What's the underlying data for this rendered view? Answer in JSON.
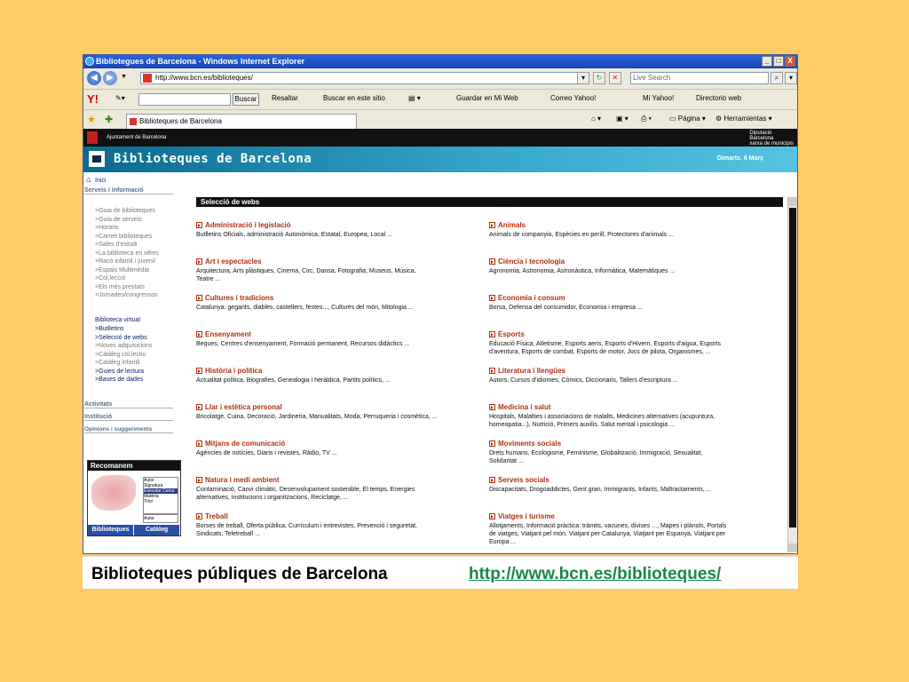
{
  "window": {
    "title": "Bibliotegues de Barcelona - Windows Internet Explorer",
    "minimize": "_",
    "maximize": "□",
    "close": "X"
  },
  "address": {
    "url": "http://www.bcn.es/biblioteques/",
    "live_search_placeholder": "Live Search"
  },
  "yahoo_toolbar": {
    "search_button": "Buscar",
    "items": [
      "Resaltar",
      "Buscar en este sitio",
      "Guardar en Mi Web",
      "Correo Yahoo!",
      "Mi Yahoo!",
      "Directorio web"
    ]
  },
  "tabs": {
    "active_tab": "Biblioteques de Barcelona",
    "pagina": "Página",
    "herramientas": "Herramientas"
  },
  "site": {
    "ajuntament": "Ajuntament de Barcelona",
    "diputacio": [
      "Diputació",
      "Barcelona",
      "xarxa de municipis"
    ],
    "title": "Biblioteques de Barcelona",
    "date": "Dimarts, 6 Març"
  },
  "sidebar": {
    "inici": "Inici",
    "serveis": "Serveis i informació",
    "items1": [
      ">Guia de biblioteques",
      ">Guia de serveis",
      ">Horaris",
      ">Carnet biblioteques",
      ">Sales d'estudi",
      ">La biblioteca en xifres",
      ">Racó infantil i juvenil",
      ">Espais Multimèdia",
      ">Col.lecció",
      ">Els més prestats",
      ">Jornades/congressos"
    ],
    "virtual": "Biblioteca virtual",
    "items2": [
      ">Butlletins",
      ">Selecció de webs",
      ">Noves adquisicions",
      ">Catàleg col.lectiu",
      ">Catàleg infantil",
      ">Guies de lectura",
      ">Bases de dades"
    ],
    "activitats": "Activitats",
    "institucio": "Institució",
    "opinions": "Opinions i suggeriments",
    "recomanem": "Recomanem",
    "rec_list": [
      "Autor",
      "Signatura",
      "Executar Cerca",
      "Matèria",
      "Títol"
    ],
    "rec_select": "Autor",
    "biblioteques_btn": "Biblioteques",
    "cataleg_btn": "Catàleg"
  },
  "main": {
    "header": "Selecció de webs",
    "left": [
      {
        "title": "Administració i legislació",
        "desc": [
          "Butlletins Oficials, administració Autonòmica, Estatal, Europea, Local ..."
        ]
      },
      {
        "title": "Art i espectacles",
        "desc": [
          "Arquitectura, Arts plàstiques, Cinema, Circ, Dansa, Fotografia, Museus, Música,",
          "Teatre ..."
        ]
      },
      {
        "title": "Cultures i tradicions",
        "desc": [
          "Catalunya: gegants, diables, castellers, festes..., Cultures del món, Mitologia ..."
        ]
      },
      {
        "title": "Ensenyament",
        "desc": [
          "Beques, Centres d'ensenyament, Formació permanent, Recursos didàctics ..."
        ]
      },
      {
        "title": "Història i política",
        "desc": [
          "Actualitat política, Biografies, Genealogia i heràldica, Partits polítics, ..."
        ]
      },
      {
        "title": "Llar i estètica personal",
        "desc": [
          "Bricolatge, Cuina, Decoració, Jardineria, Manualitats, Moda, Perruqueria i cosmètica, ..."
        ]
      },
      {
        "title": "Mitjans de comunicació",
        "desc": [
          "Agències de notícies, Diaris i revistes, Ràdio, TV ..."
        ]
      },
      {
        "title": "Natura i medi ambient",
        "desc": [
          "Contaminació, Canvi climàtic, Desenvolupament sostenible, El temps, Energies",
          "alternatives, Institucions i organitzacions, Reciclatge, ..."
        ]
      },
      {
        "title": "Treball",
        "desc": [
          "Borses de treball, Oferta pública, Currículum i entrevistes, Prevenció i seguretat,",
          "Sindicats, Teletreball ..."
        ]
      }
    ],
    "right": [
      {
        "title": "Animals",
        "desc": [
          "Animals de companyia, Espècies en perill, Protectores d'animals ..."
        ]
      },
      {
        "title": "Ciència i tecnologia",
        "desc": [
          "Agronomia, Astronomia, Astronàutica, Informàtica, Matemàtiques ..."
        ]
      },
      {
        "title": "Economia i consum",
        "desc": [
          "Borsa, Defensa del consumidor, Economia i empresa ..."
        ]
      },
      {
        "title": "Esports",
        "desc": [
          "Educació Física, Atletisme, Esports aeris, Esports d'Hivern, Esports d'aigua, Esports",
          "d'aventura, Esports de combat, Esports de motor, Jocs de pilota, Organismes, ..."
        ]
      },
      {
        "title": "Literatura i llengües",
        "desc": [
          "Autors, Cursos d'idiomes, Còmics, Diccionaris, Tallers d'escriptura ..."
        ]
      },
      {
        "title": "Medicina i salut",
        "desc": [
          "Hospitals, Malalties i associacions de malalts, Medicines alternatives (acupuntura,",
          "homeopatia...), Nutrició, Primers auxilis, Salut mental i psicologia ..."
        ]
      },
      {
        "title": "Moviments socials",
        "desc": [
          "Drets humans, Ecologisme, Feminisme, Globalització, Immigració, Sexualitat,",
          "Solidaritat ..."
        ]
      },
      {
        "title": "Serveis socials",
        "desc": [
          "Discapacitats, Drogoaddictes, Gent gran, Immigrants, Infants, Maltractaments, ..."
        ]
      },
      {
        "title": "Viatges i turisme",
        "desc": [
          "Allotjaments, Informació pràctica: tràmits, vacunes, divises ..., Mapes i plànols, Portals",
          "de viatges, Viatjant pel món, Viatjant per Catalunya, Viatjant per Espanya, Viatjant per",
          "Europa ..."
        ]
      }
    ]
  },
  "caption": {
    "text": "Biblioteques públiques de Barcelona",
    "url": "http://www.bcn.es/biblioteques/"
  }
}
